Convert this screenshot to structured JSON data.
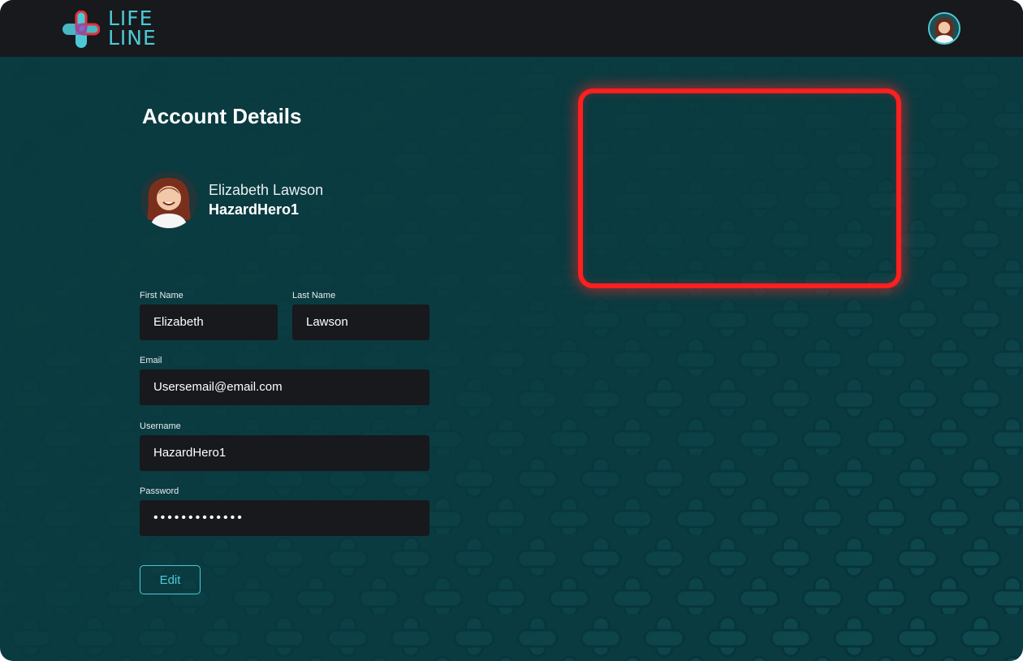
{
  "brand": {
    "line1": "LIFE",
    "line2": "LINE"
  },
  "header": {
    "avatar_icon": "user-avatar-icon"
  },
  "page": {
    "title": "Account Details"
  },
  "profile": {
    "full_name": "Elizabeth Lawson",
    "username": "HazardHero1"
  },
  "form": {
    "first_name": {
      "label": "First Name",
      "value": "Elizabeth"
    },
    "last_name": {
      "label": "Last Name",
      "value": "Lawson"
    },
    "email": {
      "label": "Email",
      "value": "Usersemail@email.com"
    },
    "username": {
      "label": "Username",
      "value": "HazardHero1"
    },
    "password": {
      "label": "Password",
      "value": "•••••••••••••"
    }
  },
  "actions": {
    "edit_label": "Edit"
  },
  "colors": {
    "accent": "#4dc9d6",
    "brand_red": "#e0323c",
    "topbar": "#17191c",
    "background": "#0a3b40",
    "highlight": "#ff1f1f"
  }
}
